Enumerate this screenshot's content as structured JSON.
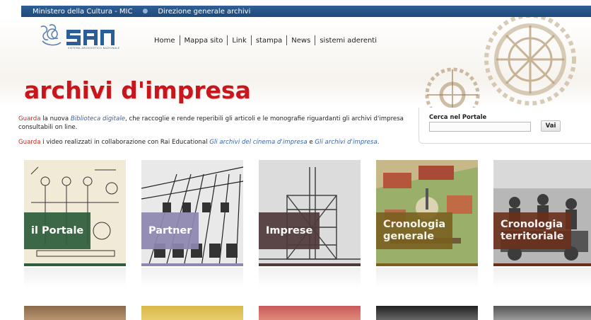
{
  "topbar": {
    "ministry": "Ministero della Cultura - MIC",
    "directorate": "Direzione generale archivi"
  },
  "logo": {
    "text": "san",
    "tagline": "SISTEMA ARCHIVISTICO NAZIONALE"
  },
  "nav": {
    "items": [
      "Home",
      "Mappa sito",
      "Link",
      "stampa",
      "News",
      "sistemi aderenti"
    ]
  },
  "site_title": "archivi d'impresa",
  "intro": {
    "p1_lead": "Guarda",
    "p1_a": " la nuova ",
    "p1_link": "Biblioteca digitale",
    "p1_b": ", che raccoglie e rende reperibili gli articoli e le monografie riguardanti gli archivi d'impresa consultabili on line.",
    "p2_lead": "Guarda",
    "p2_a": " i video realizzati in collaborazione con Rai Educational ",
    "p2_link1": "Gli archivi del cinema d'impresa",
    "p2_b": " e ",
    "p2_link2": "Gli archivi d'impresa",
    "p2_c": "."
  },
  "search": {
    "label": "Cerca nel Portale",
    "value": "",
    "button": "Vai"
  },
  "tiles": [
    {
      "line1": "il Portale",
      "line2": "",
      "color": "#2e5e3b"
    },
    {
      "line1": "Partner",
      "line2": "",
      "color": "#8e87b0"
    },
    {
      "line1": "Imprese",
      "line2": "",
      "color": "#4f3a3a"
    },
    {
      "line1": "Cronologia",
      "line2": "generale",
      "color": "#7a5f1e"
    },
    {
      "line1": "Cronologia",
      "line2": "territoriale",
      "color": "#6a2f1b"
    }
  ]
}
